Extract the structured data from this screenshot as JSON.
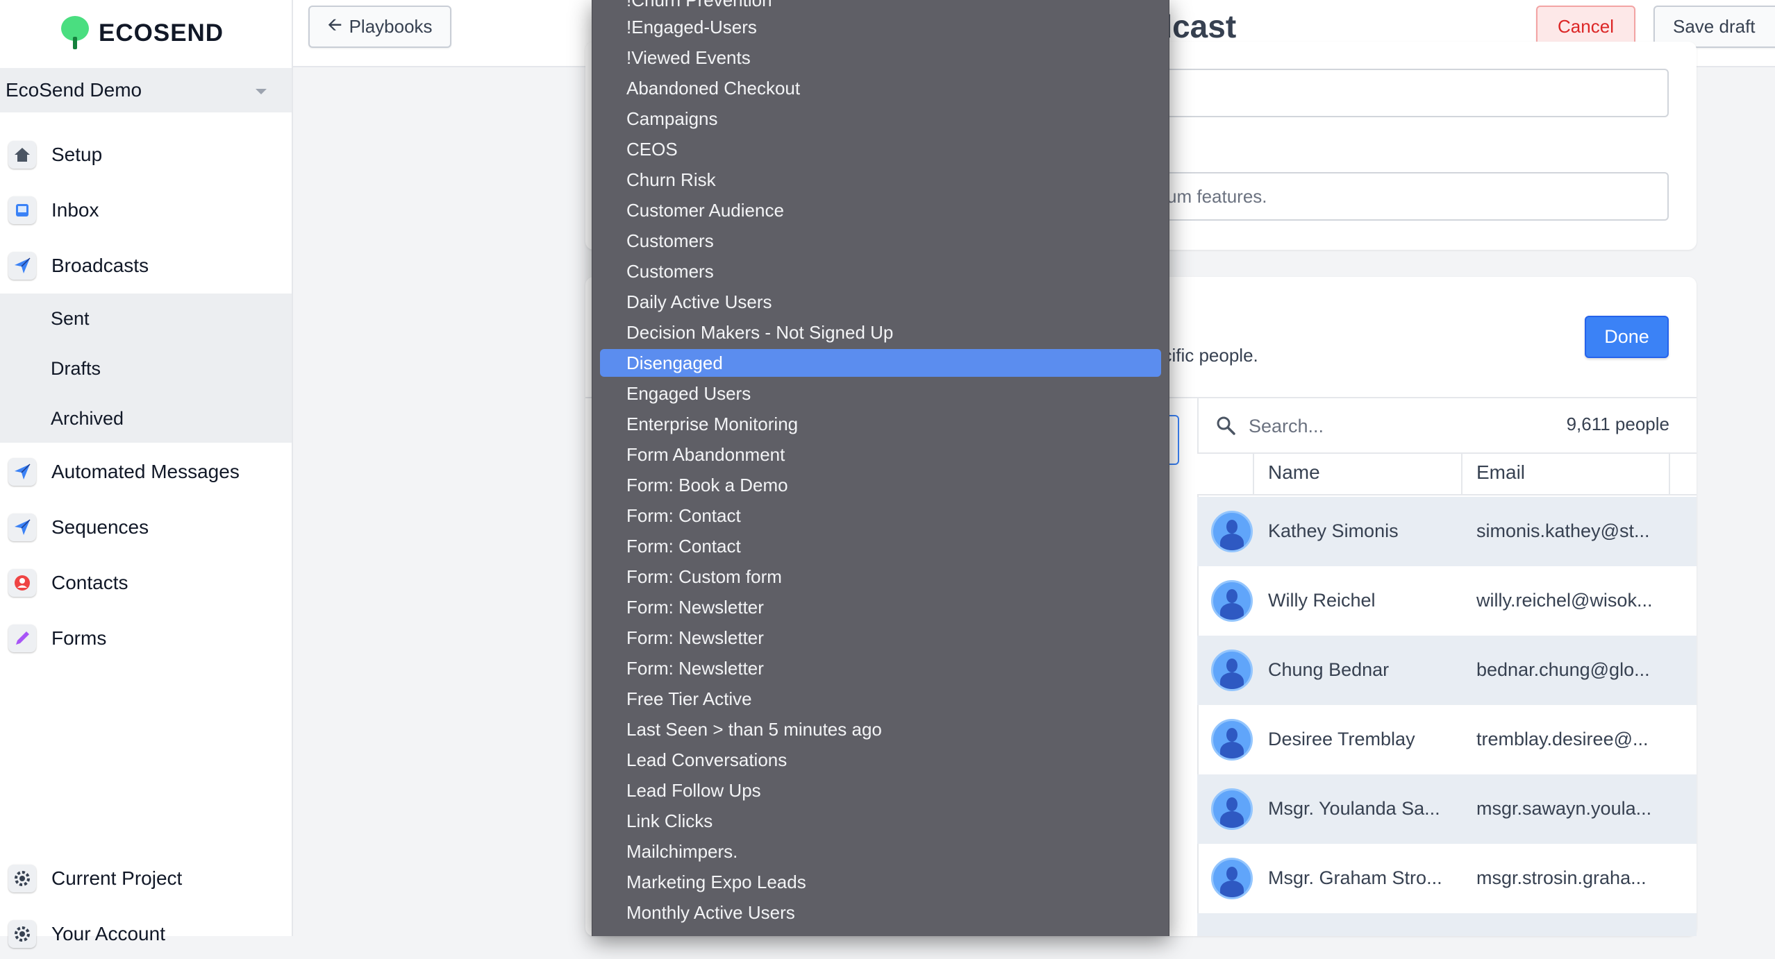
{
  "brand": {
    "name": "ECOSEND"
  },
  "workspace": {
    "name": "EcoSend Demo"
  },
  "sidebar": {
    "items": [
      {
        "label": "Setup",
        "icon": "home-icon"
      },
      {
        "label": "Inbox",
        "icon": "inbox-icon"
      },
      {
        "label": "Broadcasts",
        "icon": "send-icon"
      },
      {
        "label": "Automated Messages",
        "icon": "send-icon"
      },
      {
        "label": "Sequences",
        "icon": "send-icon"
      },
      {
        "label": "Contacts",
        "icon": "contact-icon"
      },
      {
        "label": "Forms",
        "icon": "pencil-icon"
      }
    ],
    "subitems": [
      "Sent",
      "Drafts",
      "Archived"
    ],
    "bottom": [
      {
        "label": "Current Project",
        "icon": "gear-icon"
      },
      {
        "label": "Your Account",
        "icon": "gear-icon"
      }
    ]
  },
  "topbar": {
    "back_label": "Playbooks",
    "title_fragment": "dcast",
    "cancel_label": "Cancel",
    "save_label": "Save draft"
  },
  "form": {
    "field2_text": "um features."
  },
  "audience": {
    "done_label": "Done",
    "help_fragment": "ecific people."
  },
  "people": {
    "search_placeholder": "Search...",
    "count": "9,611 people",
    "columns": [
      "Name",
      "Email"
    ],
    "rows": [
      {
        "name": "Kathey Simonis",
        "email": "simonis.kathey@st..."
      },
      {
        "name": "Willy Reichel",
        "email": "willy.reichel@wisok..."
      },
      {
        "name": "Chung Bednar",
        "email": "bednar.chung@glo..."
      },
      {
        "name": "Desiree Tremblay",
        "email": "tremblay.desiree@..."
      },
      {
        "name": "Msgr. Youlanda Sa...",
        "email": "msgr.sawayn.youla..."
      },
      {
        "name": "Msgr. Graham Stro...",
        "email": "msgr.strosin.graha..."
      }
    ]
  },
  "dropdown": {
    "selected": "Disengaged",
    "options": [
      "!Churn Prevention",
      "!Engaged-Users",
      "!Viewed Events",
      "Abandoned Checkout",
      "Campaigns",
      "CEOS",
      "Churn Risk",
      "Customer Audience",
      "Customers",
      "Customers",
      "Daily Active Users",
      "Decision Makers - Not Signed Up",
      "Disengaged",
      "Engaged Users",
      "Enterprise Monitoring",
      "Form Abandonment",
      "Form: Book a Demo",
      "Form: Contact",
      "Form: Contact",
      "Form: Custom form",
      "Form: Newsletter",
      "Form: Newsletter",
      "Form: Newsletter",
      "Free Tier Active",
      "Last Seen > than 5 minutes ago",
      "Lead Conversations",
      "Lead Follow Ups",
      "Link Clicks",
      "Mailchimpers.",
      "Marketing Expo Leads",
      "Monthly Active Users"
    ]
  },
  "colors": {
    "accent": "#3b82f6",
    "danger": "#dc2626",
    "dropdown_bg": "#5f5f66",
    "selected_bg": "#5b8def"
  }
}
